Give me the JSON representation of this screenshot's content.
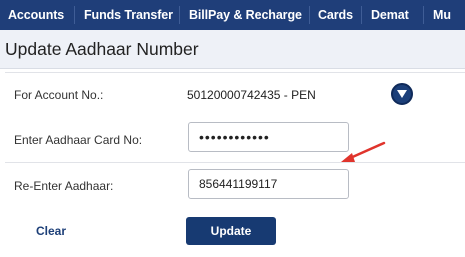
{
  "nav": {
    "items": [
      "Accounts",
      "Funds Transfer",
      "BillPay & Recharge",
      "Cards",
      "Demat",
      "Mu"
    ]
  },
  "page": {
    "title": "Update Aadhaar Number"
  },
  "form": {
    "account_label": "For Account No.:",
    "account_value": "50120000742435 - PEN",
    "aadhaar_label": "Enter Aadhaar Card No:",
    "aadhaar_value": "••••••••••••",
    "reenter_label": "Re-Enter Aadhaar:",
    "reenter_value": "856441199117"
  },
  "actions": {
    "clear_label": "Clear",
    "update_label": "Update"
  },
  "colors": {
    "nav_bg": "#1f3e79",
    "button_bg": "#173a72",
    "arrow": "#e0342c"
  },
  "icons": {
    "account_dropdown": "chevron-down-icon",
    "annotation": "red-arrow-icon"
  }
}
